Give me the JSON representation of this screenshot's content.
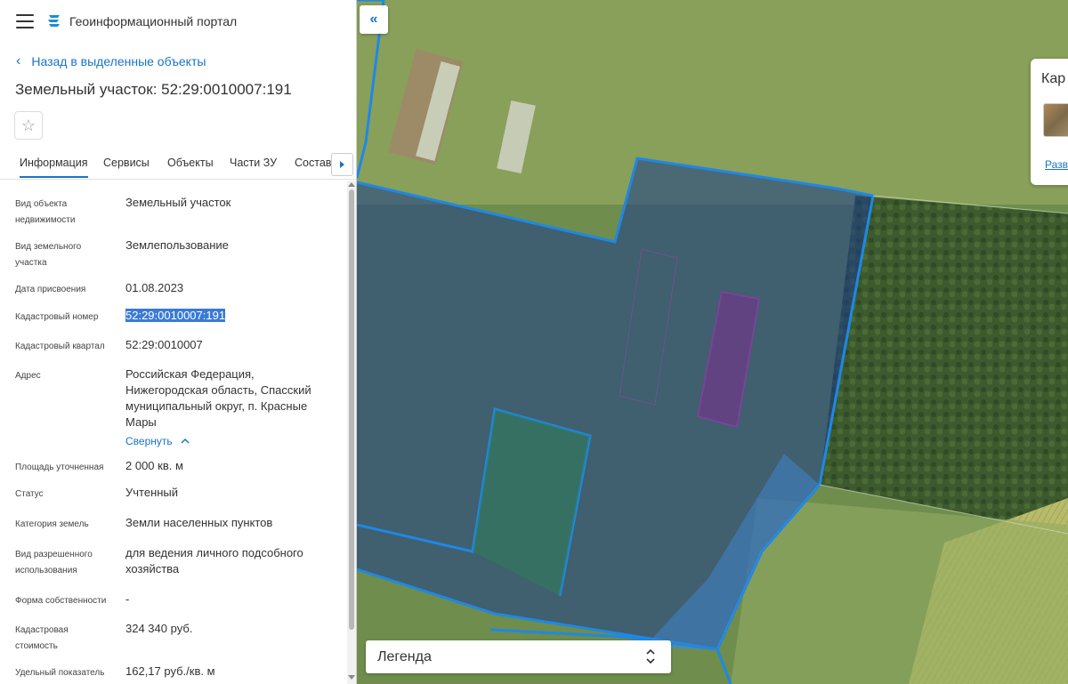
{
  "app": {
    "title": "Геоинформационный портал"
  },
  "nav": {
    "back_label": "Назад в выделенные объекты"
  },
  "object": {
    "title": "Земельный участок: 52:29:0010007:191"
  },
  "tabs": [
    {
      "label": "Информация",
      "active": true
    },
    {
      "label": "Сервисы"
    },
    {
      "label": "Объекты"
    },
    {
      "label": "Части ЗУ"
    },
    {
      "label": "Состав"
    }
  ],
  "properties": [
    {
      "label": "Вид объекта недвижимости",
      "value": "Земельный участок"
    },
    {
      "label": "Вид земельного участка",
      "value": "Землепользование"
    },
    {
      "label": "Дата присвоения",
      "value": "01.08.2023"
    },
    {
      "label": "Кадастровый номер",
      "value": "52:29:0010007:191",
      "selected": true
    },
    {
      "label": "Кадастровый квартал",
      "value": "52:29:0010007"
    },
    {
      "label": "Адрес",
      "value": "Российская Федерация, Нижегородская область, Спасский муниципальный округ, п. Красные Мары"
    },
    {
      "label": "Площадь уточненная",
      "value": "2 000 кв. м"
    },
    {
      "label": "Статус",
      "value": "Учтенный"
    },
    {
      "label": "Категория земель",
      "value": "Земли населенных пунктов"
    },
    {
      "label": "Вид разрешенного использования",
      "value": "для ведения личного подсобного хозяйства"
    },
    {
      "label": "Форма собственности",
      "value": "-"
    },
    {
      "label": "Кадастровая стоимость",
      "value": "324 340 руб."
    },
    {
      "label": "Удельный показатель",
      "value": "162,17 руб./кв. м"
    }
  ],
  "address_toggle": {
    "label": "Свернуть"
  },
  "map": {
    "card_title": "Кар",
    "card_link": "Разв",
    "legend_label": "Легенда",
    "parcel_color": "#1e88e5"
  }
}
